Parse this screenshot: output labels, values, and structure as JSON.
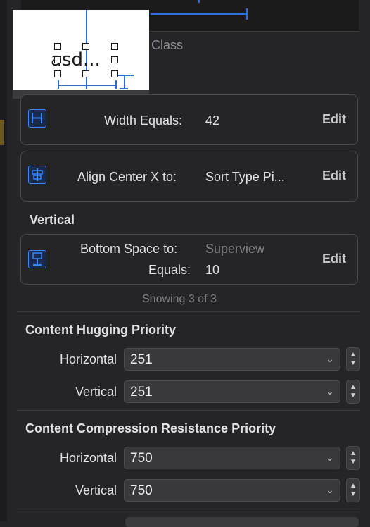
{
  "preview": {
    "label": "asd..."
  },
  "top": {
    "class_label": "e Class"
  },
  "constraints": [
    {
      "icon": "width-constraint-icon",
      "label": "Width Equals:",
      "value": "42",
      "edit": "Edit"
    },
    {
      "icon": "align-center-x-icon",
      "label": "Align Center X to:",
      "value": "Sort Type Pi...",
      "edit": "Edit"
    }
  ],
  "vertical_section": {
    "title": "Vertical",
    "bottom_space": {
      "label1": "Bottom Space to:",
      "value1": "Superview",
      "label2": "Equals:",
      "value2": "10",
      "edit": "Edit"
    },
    "showing": "Showing 3 of 3"
  },
  "hugging": {
    "title": "Content Hugging Priority",
    "horizontal_label": "Horizontal",
    "horizontal_value": "251",
    "vertical_label": "Vertical",
    "vertical_value": "251"
  },
  "compression": {
    "title": "Content Compression Resistance Priority",
    "horizontal_label": "Horizontal",
    "horizontal_value": "750",
    "vertical_label": "Vertical",
    "vertical_value": "750"
  },
  "colors": {
    "accent": "#3a86ff",
    "panel": "#252527"
  }
}
